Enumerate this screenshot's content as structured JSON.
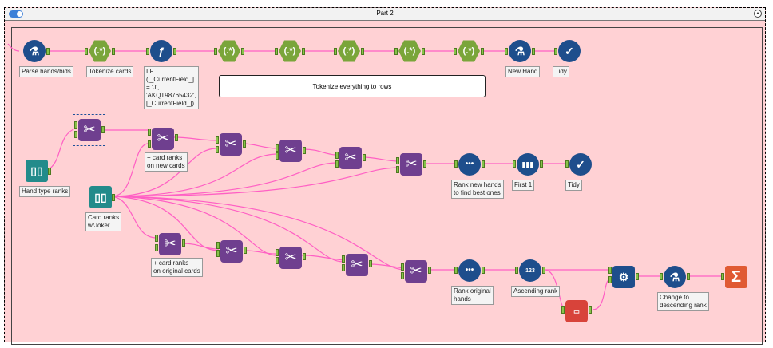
{
  "container": {
    "title": "Part 2"
  },
  "comment": {
    "text": "Tokenize everything to rows"
  },
  "labels": {
    "parse_hands": "Parse hands/bids",
    "tokenize_cards": "Tokenize cards",
    "formula": "IIF\n([_CurrentField_]\n= 'J',\n'AKQT98765432',\n[_CurrentField_])",
    "new_hand": "New Hand",
    "tidy_top": "Tidy",
    "hand_type_ranks": "Hand type ranks",
    "card_ranks_joker": "Card ranks\nw/Joker",
    "card_ranks_new": "+ card ranks\non new cards",
    "rank_new_hands": "Rank new hands\nto find best ones",
    "first_1": "First 1",
    "tidy_mid": "Tidy",
    "card_ranks_original": "+ card ranks\non original cards",
    "rank_original": "Rank original\nhands",
    "ascending_rank": "Ascending rank",
    "change_desc": "Change to\ndescending rank"
  },
  "tool_glyphs": {
    "regex": "(.*)",
    "sigma": "Σ",
    "rank_dots": "•••",
    "sort_nums": "123",
    "tidy": "✓",
    "flask": "⚗",
    "first": "▮▮▮",
    "gear": "⚙",
    "join": "⨯",
    "cross": "✂",
    "book": "▯▯",
    "formula": "ƒ"
  },
  "colors": {
    "container_bg": "#ffd1d4",
    "wire": "#ff5fc4",
    "regex": "#7aa53a",
    "join": "#6f3f8f",
    "blue_tool": "#1e4e8c",
    "teal_tool": "#238b8b",
    "summarize": "#e05a33"
  }
}
